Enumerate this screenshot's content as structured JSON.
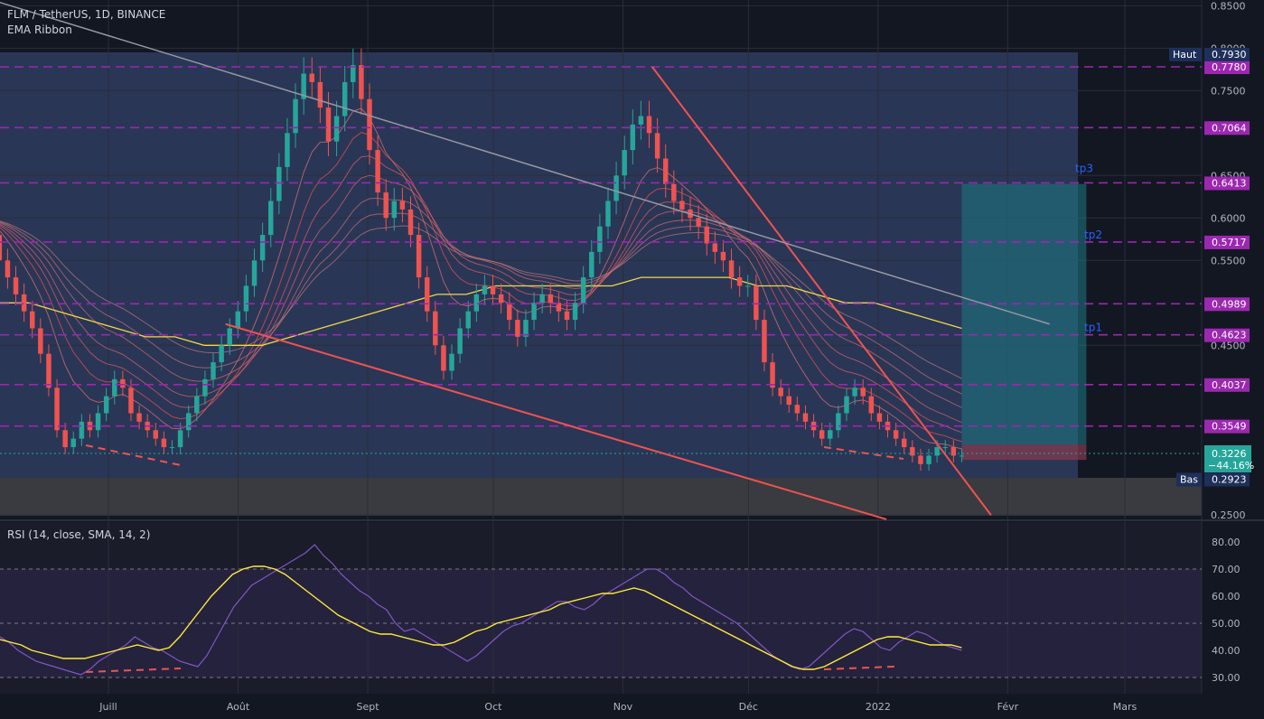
{
  "header": {
    "symbol_line": "FLM / TetherUS, 1D, BINANCE",
    "indicator": "EMA Ribbon",
    "rsi_label": "RSI (14, close, SMA, 14, 2)"
  },
  "chart_data": [
    {
      "type": "candlestick",
      "title": "FLM / TetherUS, 1D, BINANCE",
      "x_ticks": [
        {
          "label": "Juill",
          "date": "2021-07-01"
        },
        {
          "label": "Août",
          "date": "2021-08-01"
        },
        {
          "label": "Sept",
          "date": "2021-09-01"
        },
        {
          "label": "Oct",
          "date": "2021-10-01"
        },
        {
          "label": "Nov",
          "date": "2021-11-01"
        },
        {
          "label": "Déc",
          "date": "2021-12-01"
        },
        {
          "label": "2022",
          "date": "2022-01-01"
        },
        {
          "label": "Févr",
          "date": "2022-02-01"
        },
        {
          "label": "Mars",
          "date": "2022-03-01"
        }
      ],
      "y_ticks": [
        "0.8500",
        "0.8000",
        "0.7500",
        "0.6500",
        "0.6000",
        "0.5500",
        "0.4500",
        "0.2500"
      ],
      "ylim": [
        0.25,
        0.85
      ],
      "price_levels": [
        {
          "label": "0.7780",
          "value": 0.778,
          "color": "#9c27b0"
        },
        {
          "label": "0.7064",
          "value": 0.7064,
          "color": "#9c27b0"
        },
        {
          "label": "0.6413",
          "value": 0.6413,
          "color": "#9c27b0"
        },
        {
          "label": "0.5717",
          "value": 0.5717,
          "color": "#9c27b0"
        },
        {
          "label": "0.4989",
          "value": 0.4989,
          "color": "#9c27b0"
        },
        {
          "label": "0.4623",
          "value": 0.4623,
          "color": "#9c27b0"
        },
        {
          "label": "0.4037",
          "value": 0.4037,
          "color": "#9c27b0"
        },
        {
          "label": "0.3549",
          "value": 0.3549,
          "color": "#9c27b0"
        }
      ],
      "range_high": {
        "tag": "Haut",
        "label": "0.7930",
        "value": 0.793
      },
      "range_low": {
        "tag": "Bas",
        "label": "0.2923",
        "value": 0.2923
      },
      "last_price": {
        "label": "0.3226",
        "change": "−44.16%",
        "value": 0.3226
      },
      "targets": [
        {
          "label": "tp3",
          "value": 0.65
        },
        {
          "label": "tp2",
          "value": 0.5717
        },
        {
          "label": "tp1",
          "value": 0.4623
        }
      ],
      "trendlines": [
        {
          "color": "#ef5350",
          "from": [
            "2021-07-29",
            0.475
          ],
          "to": [
            "2022-01-03",
            0.245
          ]
        },
        {
          "color": "#ef5350",
          "from": [
            "2021-11-08",
            0.778
          ],
          "to": [
            "2022-01-28",
            0.25
          ]
        },
        {
          "color": "#9598a1",
          "from": [
            "2021-06-01",
            0.86
          ],
          "to": [
            "2022-02-11",
            0.475
          ]
        }
      ],
      "close_series": [
        0.6,
        0.58,
        0.55,
        0.53,
        0.51,
        0.49,
        0.47,
        0.44,
        0.4,
        0.35,
        0.33,
        0.34,
        0.36,
        0.35,
        0.37,
        0.39,
        0.41,
        0.4,
        0.37,
        0.36,
        0.35,
        0.34,
        0.33,
        0.33,
        0.35,
        0.37,
        0.39,
        0.41,
        0.43,
        0.45,
        0.47,
        0.49,
        0.52,
        0.55,
        0.58,
        0.62,
        0.66,
        0.7,
        0.74,
        0.77,
        0.76,
        0.73,
        0.69,
        0.72,
        0.76,
        0.78,
        0.74,
        0.68,
        0.63,
        0.6,
        0.62,
        0.61,
        0.58,
        0.53,
        0.49,
        0.45,
        0.42,
        0.44,
        0.47,
        0.49,
        0.51,
        0.52,
        0.51,
        0.5,
        0.48,
        0.46,
        0.48,
        0.5,
        0.51,
        0.5,
        0.49,
        0.48,
        0.5,
        0.53,
        0.56,
        0.59,
        0.62,
        0.65,
        0.68,
        0.71,
        0.72,
        0.7,
        0.67,
        0.64,
        0.62,
        0.61,
        0.6,
        0.59,
        0.57,
        0.56,
        0.55,
        0.53,
        0.52,
        0.52,
        0.48,
        0.43,
        0.4,
        0.39,
        0.38,
        0.37,
        0.36,
        0.35,
        0.34,
        0.35,
        0.37,
        0.39,
        0.4,
        0.39,
        0.37,
        0.36,
        0.35,
        0.34,
        0.33,
        0.32,
        0.31,
        0.32,
        0.33,
        0.33,
        0.32,
        0.32
      ],
      "ema_close_series": [
        0.5,
        0.5,
        0.49,
        0.48,
        0.47,
        0.46,
        0.46,
        0.45,
        0.45,
        0.45,
        0.46,
        0.47,
        0.48,
        0.49,
        0.5,
        0.51,
        0.51,
        0.52,
        0.52,
        0.52,
        0.52,
        0.52,
        0.53,
        0.53,
        0.53,
        0.53,
        0.52,
        0.52,
        0.51,
        0.5,
        0.5,
        0.49,
        0.48,
        0.47
      ]
    },
    {
      "type": "line",
      "title": "RSI (14, close, SMA, 14, 2)",
      "y_ticks": [
        "80.00",
        "70.00",
        "60.00",
        "50.00",
        "40.00",
        "30.00"
      ],
      "ylim": [
        25,
        85
      ],
      "bands": [
        70,
        50,
        30
      ],
      "series": [
        {
          "name": "RSI",
          "color": "#7e57c2",
          "values": [
            45,
            43,
            40,
            38,
            36,
            35,
            34,
            33,
            32,
            31,
            33,
            36,
            38,
            40,
            42,
            45,
            43,
            41,
            40,
            38,
            36,
            35,
            34,
            38,
            44,
            50,
            56,
            60,
            64,
            66,
            68,
            70,
            72,
            74,
            76,
            79,
            75,
            72,
            68,
            65,
            62,
            60,
            57,
            55,
            50,
            47,
            48,
            46,
            44,
            42,
            40,
            38,
            36,
            38,
            41,
            44,
            47,
            49,
            50,
            52,
            54,
            56,
            58,
            58,
            56,
            55,
            57,
            60,
            62,
            64,
            66,
            68,
            70,
            70,
            68,
            65,
            63,
            60,
            58,
            56,
            54,
            52,
            50,
            47,
            44,
            41,
            38,
            36,
            34,
            33,
            34,
            37,
            40,
            43,
            46,
            48,
            47,
            44,
            41,
            40,
            43,
            45,
            47,
            46,
            44,
            42,
            41,
            40
          ]
        },
        {
          "name": "RSI-based MA",
          "color": "#ffeb3b",
          "values": [
            44,
            43,
            42,
            40,
            39,
            38,
            37,
            37,
            37,
            38,
            39,
            40,
            41,
            42,
            41,
            40,
            41,
            45,
            50,
            55,
            60,
            64,
            68,
            70,
            71,
            71,
            70,
            68,
            65,
            62,
            59,
            56,
            53,
            51,
            49,
            47,
            46,
            46,
            45,
            44,
            43,
            42,
            42,
            43,
            45,
            47,
            48,
            50,
            51,
            52,
            53,
            54,
            55,
            57,
            58,
            59,
            60,
            61,
            61,
            62,
            63,
            62,
            60,
            58,
            56,
            54,
            52,
            50,
            48,
            46,
            44,
            42,
            40,
            38,
            36,
            34,
            33,
            33,
            34,
            36,
            38,
            40,
            42,
            44,
            45,
            45,
            44,
            43,
            42,
            42,
            42,
            41
          ]
        }
      ]
    }
  ]
}
